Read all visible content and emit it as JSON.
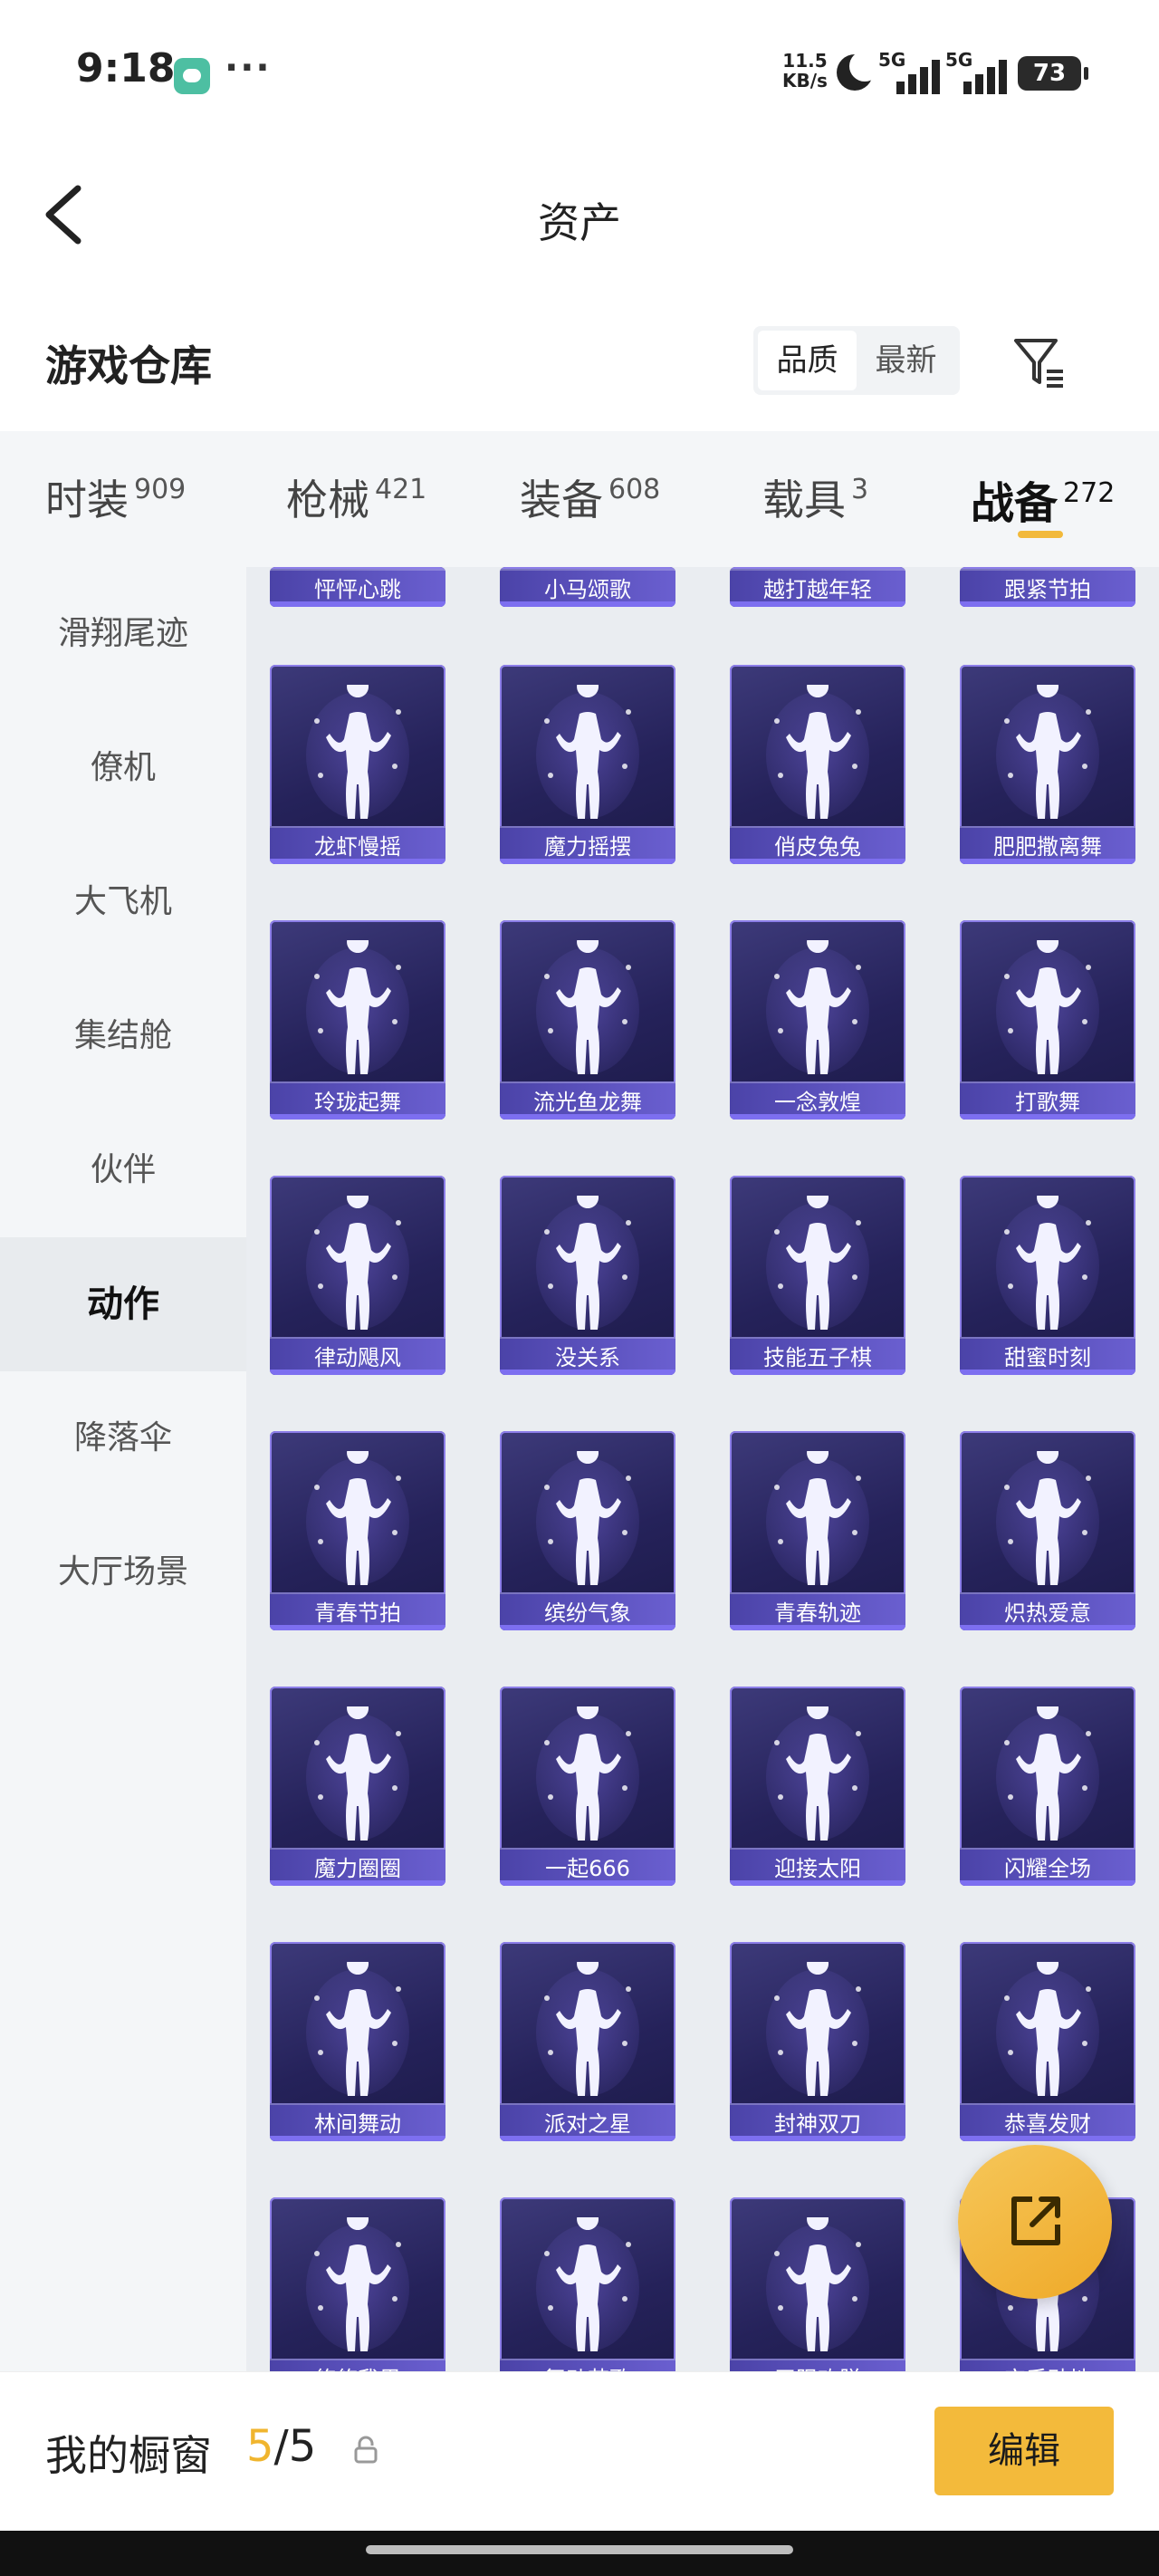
{
  "status_bar": {
    "time": "9:18",
    "net_speed_value": "11.5",
    "net_speed_unit": "KB/s",
    "signal_1": "5G",
    "signal_2": "5G",
    "battery": "73"
  },
  "header": {
    "title": "资产"
  },
  "section": {
    "title": "游戏仓库",
    "sort_options": [
      "品质",
      "最新"
    ],
    "active_sort": "品质"
  },
  "tabs": [
    {
      "label": "时装",
      "count": "909"
    },
    {
      "label": "枪械",
      "count": "421"
    },
    {
      "label": "装备",
      "count": "608"
    },
    {
      "label": "载具",
      "count": "3"
    },
    {
      "label": "战备",
      "count": "272"
    }
  ],
  "active_tab": "战备",
  "sidebar": [
    {
      "label": "滑翔尾迹"
    },
    {
      "label": "僚机"
    },
    {
      "label": "大飞机"
    },
    {
      "label": "集结舱"
    },
    {
      "label": "伙伴"
    },
    {
      "label": "动作"
    },
    {
      "label": "降落伞"
    },
    {
      "label": "大厅场景"
    }
  ],
  "active_sidebar": "动作",
  "partial_row": [
    "怦怦心跳",
    "小马颂歌",
    "越打越年轻",
    "跟紧节拍"
  ],
  "grid_rows": [
    [
      "龙虾慢摇",
      "魔力摇摆",
      "俏皮兔兔",
      "肥肥撒离舞"
    ],
    [
      "玲珑起舞",
      "流光鱼龙舞",
      "一念敦煌",
      "打歌舞"
    ],
    [
      "律动飓风",
      "没关系",
      "技能五子棋",
      "甜蜜时刻"
    ],
    [
      "青春节拍",
      "缤纷气象",
      "青春轨迹",
      "炽热爱意"
    ],
    [
      "魔力圈圈",
      "一起666",
      "迎接太阳",
      "闪耀全场"
    ],
    [
      "林间舞动",
      "派对之星",
      "封神双刀",
      "恭喜发财"
    ],
    [
      "悠悠我思",
      "舞动苗歌",
      "无限欢脱",
      "空手劲地"
    ]
  ],
  "bottom_bar": {
    "label": "我的橱窗",
    "current": "5",
    "total": "/5",
    "edit_label": "编辑"
  },
  "colors": {
    "accent": "#f3ba3b",
    "card_bg": "#2a275f",
    "card_label": "#5a50c0"
  }
}
